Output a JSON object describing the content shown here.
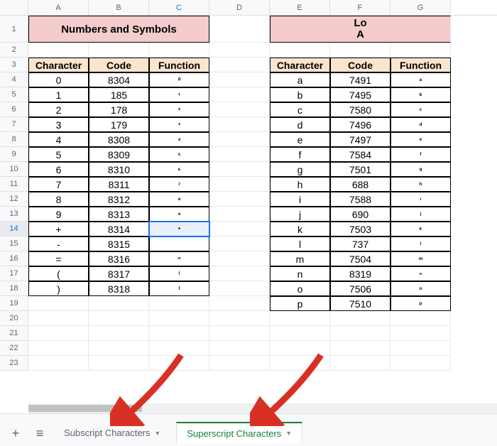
{
  "columns": [
    "A",
    "B",
    "C",
    "D",
    "E",
    "F",
    "G"
  ],
  "active_column_index": 2,
  "row_labels": [
    "1",
    "2",
    "3",
    "4",
    "5",
    "6",
    "7",
    "8",
    "9",
    "10",
    "11",
    "12",
    "13",
    "14",
    "15",
    "16",
    "17",
    "18",
    "19",
    "20",
    "21",
    "22",
    "23"
  ],
  "selected_row": 14,
  "title_left": "Numbers and Symbols",
  "title_right_line1": "Lo",
  "title_right_line2": "A",
  "headers": [
    "Character",
    "Code",
    "Function"
  ],
  "left_table": [
    {
      "char": "0",
      "code": "8304",
      "func": "⁰"
    },
    {
      "char": "1",
      "code": "185",
      "func": "¹"
    },
    {
      "char": "2",
      "code": "178",
      "func": "²"
    },
    {
      "char": "3",
      "code": "179",
      "func": "³"
    },
    {
      "char": "4",
      "code": "8308",
      "func": "⁴"
    },
    {
      "char": "5",
      "code": "8309",
      "func": "⁵"
    },
    {
      "char": "6",
      "code": "8310",
      "func": "⁶"
    },
    {
      "char": "7",
      "code": "8311",
      "func": "⁷"
    },
    {
      "char": "8",
      "code": "8312",
      "func": "⁸"
    },
    {
      "char": "9",
      "code": "8313",
      "func": "⁹"
    },
    {
      "char": "+",
      "code": "8314",
      "func": "⁺"
    },
    {
      "char": "-",
      "code": "8315",
      "func": ""
    },
    {
      "char": "=",
      "code": "8316",
      "func": "⁼"
    },
    {
      "char": "(",
      "code": "8317",
      "func": "⁽"
    },
    {
      "char": ")",
      "code": "8318",
      "func": "⁾"
    }
  ],
  "right_table": [
    {
      "char": "a",
      "code": "7491",
      "func": "ᵃ"
    },
    {
      "char": "b",
      "code": "7495",
      "func": "ᵇ"
    },
    {
      "char": "c",
      "code": "7580",
      "func": "ᶜ"
    },
    {
      "char": "d",
      "code": "7496",
      "func": "ᵈ"
    },
    {
      "char": "e",
      "code": "7497",
      "func": "ᵉ"
    },
    {
      "char": "f",
      "code": "7584",
      "func": "ᶠ"
    },
    {
      "char": "g",
      "code": "7501",
      "func": "ᵍ"
    },
    {
      "char": "h",
      "code": "688",
      "func": "ʰ"
    },
    {
      "char": "i",
      "code": "7588",
      "func": "ᶦ"
    },
    {
      "char": "j",
      "code": "690",
      "func": "ʲ"
    },
    {
      "char": "k",
      "code": "7503",
      "func": "ᵏ"
    },
    {
      "char": "l",
      "code": "737",
      "func": "ˡ"
    },
    {
      "char": "m",
      "code": "7504",
      "func": "ᵐ"
    },
    {
      "char": "n",
      "code": "8319",
      "func": "ⁿ"
    },
    {
      "char": "o",
      "code": "7506",
      "func": "ᵒ"
    },
    {
      "char": "p",
      "code": "7510",
      "func": "ᵖ"
    }
  ],
  "tabs": {
    "add_label": "+",
    "menu_label": "≡",
    "inactive": "Subscript Characters",
    "active": "Superscript Characters"
  }
}
